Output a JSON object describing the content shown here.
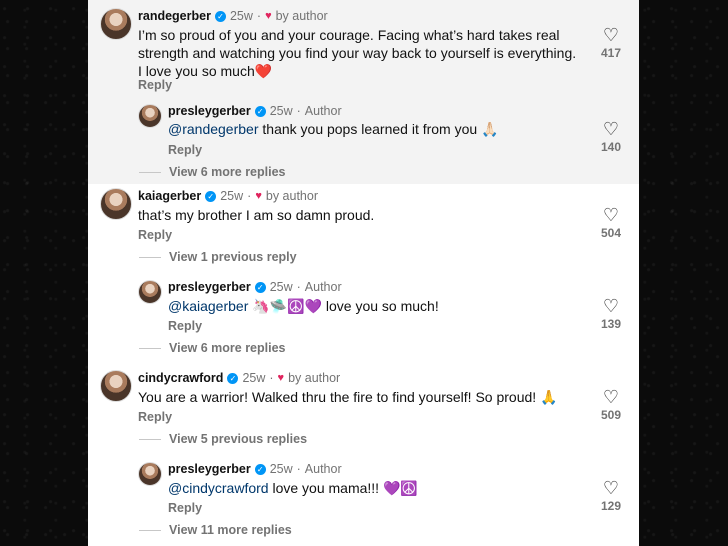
{
  "comments": [
    {
      "username": "randegerber",
      "time": "25w",
      "liked_label": "by author",
      "text": "I’m so proud of you and your courage. Facing what’s hard takes real strength and watching you find your way back to yourself is everything. I love you so much❤️",
      "reply_label": "Reply",
      "likes": "417",
      "reply": {
        "username": "presleygerber",
        "time": "25w",
        "author_label": "Author",
        "mention": "@randegerber",
        "text": " thank you pops learned it from you 🙏🏻",
        "reply_label": "Reply",
        "likes": "140"
      },
      "view_more": "View 6 more replies"
    },
    {
      "username": "kaiagerber",
      "time": "25w",
      "liked_label": "by author",
      "text": "that’s my brother I am so damn proud.",
      "reply_label": "Reply",
      "likes": "504",
      "view_previous": "View 1 previous reply",
      "reply": {
        "username": "presleygerber",
        "time": "25w",
        "author_label": "Author",
        "mention": "@kaiagerber",
        "text": " 🦄🛸☮️💜 love you so much!",
        "reply_label": "Reply",
        "likes": "139"
      },
      "view_more": "View 6 more replies"
    },
    {
      "username": "cindycrawford",
      "time": "25w",
      "liked_label": "by author",
      "text": "You are a warrior!  Walked thru the fire to find yourself!  So proud! 🙏",
      "reply_label": "Reply",
      "likes": "509",
      "view_previous": "View 5 previous replies",
      "reply": {
        "username": "presleygerber",
        "time": "25w",
        "author_label": "Author",
        "mention": "@cindycrawford",
        "text": " love you mama!!! 💜☮️",
        "reply_label": "Reply",
        "likes": "129"
      },
      "view_more": "View 11 more replies"
    }
  ],
  "separator": "·",
  "icons": {
    "like": "heart-outline-icon",
    "liked_by_author": "heart-filled-icon",
    "verified": "verified-badge-icon"
  },
  "colors": {
    "verified": "#0095f6",
    "author_heart": "#e0245e",
    "mention": "#00376b"
  }
}
